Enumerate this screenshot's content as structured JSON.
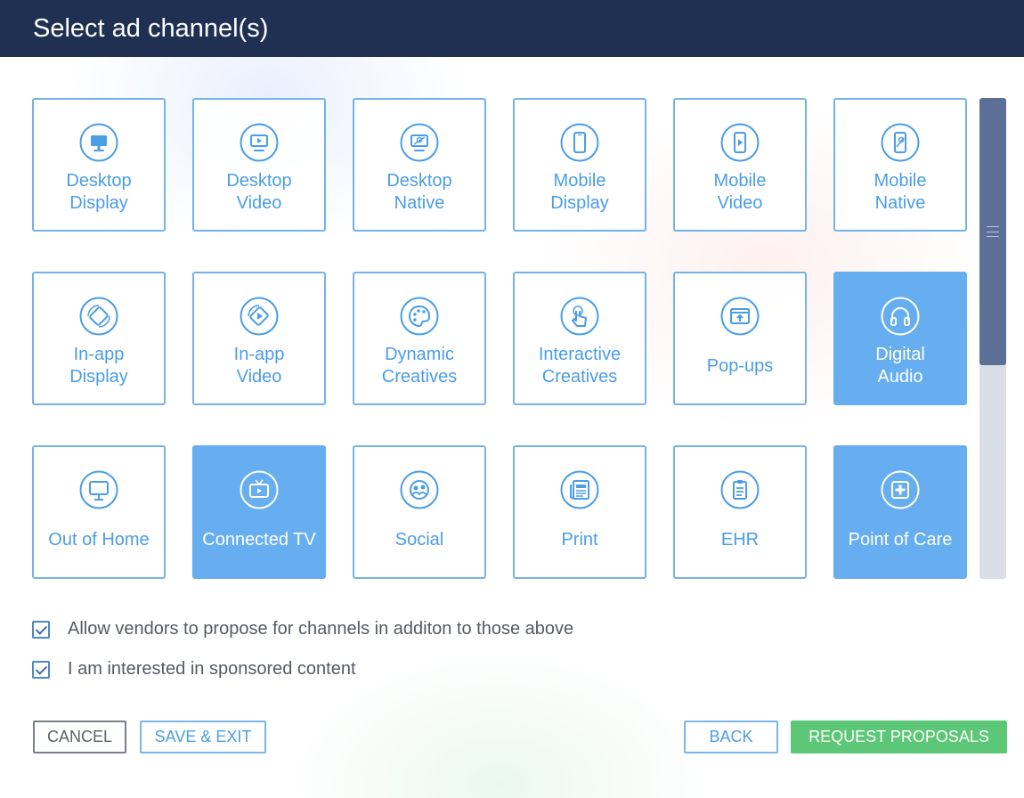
{
  "header": {
    "title": "Select ad channel(s)"
  },
  "channels": [
    {
      "label": "Desktop\nDisplay",
      "icon": "desktop-icon",
      "selected": false
    },
    {
      "label": "Desktop\nVideo",
      "icon": "desktop-video-icon",
      "selected": false
    },
    {
      "label": "Desktop\nNative",
      "icon": "desktop-native-icon",
      "selected": false
    },
    {
      "label": "Mobile\nDisplay",
      "icon": "mobile-icon",
      "selected": false
    },
    {
      "label": "Mobile\nVideo",
      "icon": "mobile-video-icon",
      "selected": false
    },
    {
      "label": "Mobile\nNative",
      "icon": "mobile-native-icon",
      "selected": false
    },
    {
      "label": "In-app\nDisplay",
      "icon": "rotate-device-icon",
      "selected": false
    },
    {
      "label": "In-app\nVideo",
      "icon": "rotate-video-icon",
      "selected": false
    },
    {
      "label": "Dynamic\nCreatives",
      "icon": "palette-icon",
      "selected": false
    },
    {
      "label": "Interactive\nCreatives",
      "icon": "touch-icon",
      "selected": false
    },
    {
      "label": "Pop-ups",
      "icon": "popup-icon",
      "selected": false
    },
    {
      "label": "Digital\nAudio",
      "icon": "headphones-icon",
      "selected": true
    },
    {
      "label": "Out of Home",
      "icon": "billboard-icon",
      "selected": false
    },
    {
      "label": "Connected TV",
      "icon": "tv-icon",
      "selected": true
    },
    {
      "label": "Social",
      "icon": "social-icon",
      "selected": false
    },
    {
      "label": "Print",
      "icon": "newspaper-icon",
      "selected": false
    },
    {
      "label": "EHR",
      "icon": "clipboard-icon",
      "selected": false
    },
    {
      "label": "Point of Care",
      "icon": "medical-cross-icon",
      "selected": true
    }
  ],
  "options": {
    "allow_vendors": {
      "label": "Allow vendors to propose for channels in additon to those above",
      "checked": true
    },
    "sponsored_content": {
      "label": "I am interested in sponsored content",
      "checked": true
    }
  },
  "buttons": {
    "cancel": "CANCEL",
    "save_exit": "SAVE & EXIT",
    "back": "BACK",
    "request_proposals": "REQUEST PROPOSALS"
  },
  "colors": {
    "header_bg": "#1f3052",
    "tile_border": "#74b3e8",
    "tile_text": "#4a9de6",
    "tile_selected_bg": "#66aef0",
    "primary_button": "#5bc777"
  }
}
